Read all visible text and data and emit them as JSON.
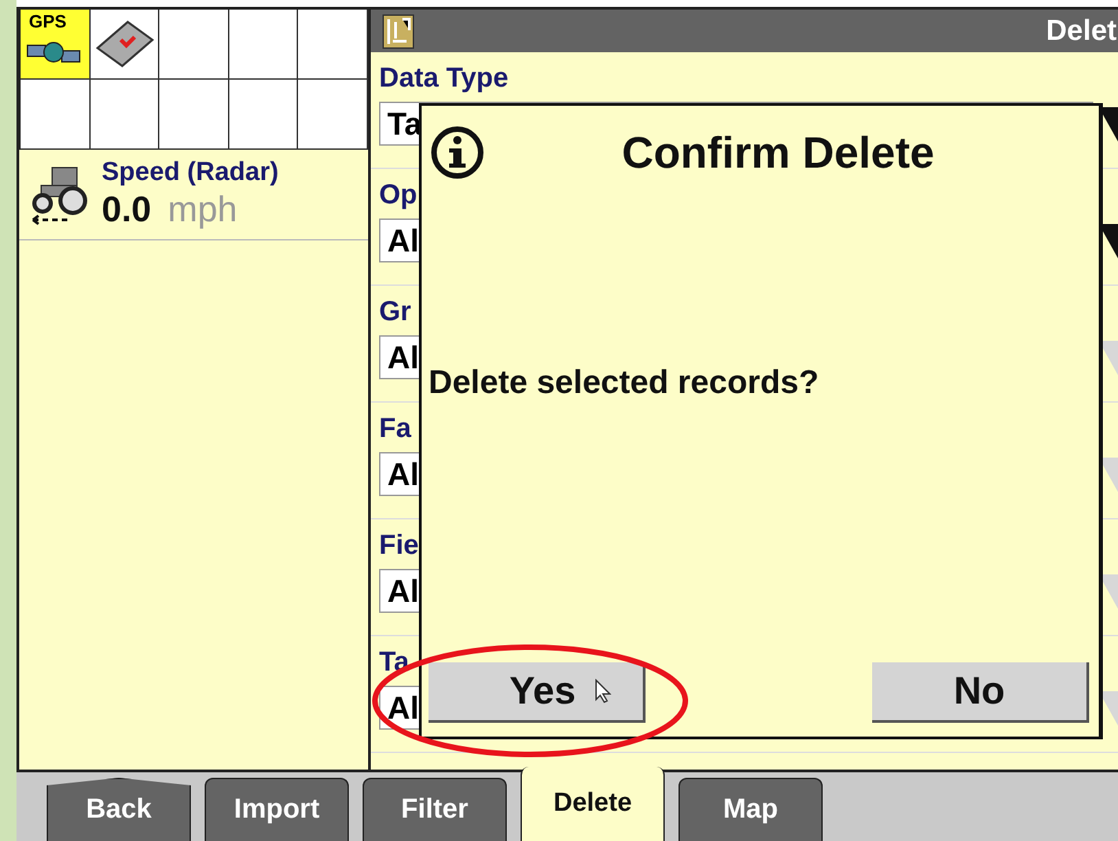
{
  "status_cells": [
    {
      "kind": "gps",
      "label": "GPS"
    },
    {
      "kind": "card"
    },
    {
      "kind": "empty"
    },
    {
      "kind": "empty"
    },
    {
      "kind": "empty"
    },
    {
      "kind": "empty"
    },
    {
      "kind": "empty"
    },
    {
      "kind": "empty"
    },
    {
      "kind": "empty"
    },
    {
      "kind": "empty"
    }
  ],
  "speed": {
    "label": "Speed (Radar)",
    "value": "0.0",
    "unit": "mph"
  },
  "panel": {
    "title": "Delet"
  },
  "fields": [
    {
      "label": "Data Type",
      "value": "Ta",
      "disabled": false
    },
    {
      "label": "Op",
      "value": "Al",
      "disabled": false
    },
    {
      "label": "Gr",
      "value": "Al",
      "disabled": true
    },
    {
      "label": "Fa",
      "value": "Al",
      "disabled": true
    },
    {
      "label": "Fie",
      "value": "Al",
      "disabled": true
    },
    {
      "label": "Ta",
      "value": "Al",
      "disabled": true
    }
  ],
  "dialog": {
    "title": "Confirm Delete",
    "message": "Delete selected records?",
    "buttons": [
      {
        "label": "Yes"
      },
      {
        "label": "No"
      }
    ]
  },
  "tabs": [
    {
      "label": "Back",
      "kind": "back",
      "selected": false
    },
    {
      "label": "Import",
      "kind": "normal",
      "selected": false
    },
    {
      "label": "Filter",
      "kind": "normal",
      "selected": false
    },
    {
      "label": "Delete",
      "kind": "normal",
      "selected": true
    },
    {
      "label": "Map",
      "kind": "normal",
      "selected": false
    }
  ]
}
